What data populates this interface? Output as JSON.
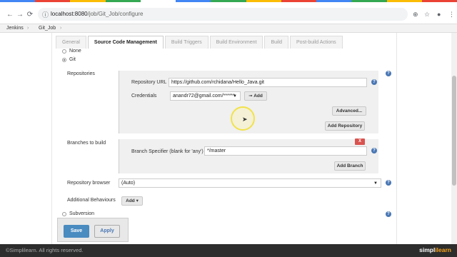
{
  "colorbar": [
    "#4285f4",
    "#ea4335",
    "#fbbc05",
    "#34a853",
    "#ffffff",
    "#4285f4",
    "#34a853",
    "#fbbc05",
    "#ea4335",
    "#4285f4",
    "#34a853",
    "#fbbc05",
    "#ea4335"
  ],
  "browser": {
    "url_host": "localhost:8080",
    "url_path": "/job/Git_Job/configure"
  },
  "breadcrumb": {
    "items": [
      "Jenkins",
      "Git_Job"
    ],
    "separator": "›"
  },
  "tabs": [
    "General",
    "Source Code Management",
    "Build Triggers",
    "Build Environment",
    "Build",
    "Post-build Actions"
  ],
  "active_tab": "Source Code Management",
  "scm": {
    "none_label": "None",
    "git_label": "Git",
    "subversion_label": "Subversion",
    "selected": "Git"
  },
  "repositories": {
    "section_label": "Repositories",
    "url_label": "Repository URL",
    "url_value": "https://github.com/rchidana/Hello_Java.git",
    "credentials_label": "Credentials",
    "credentials_value": "anandr72@gmail.com/******",
    "add_button": "Add",
    "advanced_button": "Advanced...",
    "add_repository_button": "Add Repository"
  },
  "branches": {
    "section_label": "Branches to build",
    "specifier_label": "Branch Specifier (blank for 'any')",
    "specifier_value": "*/master",
    "delete_button": "X",
    "add_branch_button": "Add Branch"
  },
  "repo_browser": {
    "label": "Repository browser",
    "value": "(Auto)"
  },
  "additional": {
    "label": "Additional Behaviours",
    "add_button": "Add"
  },
  "actions": {
    "save": "Save",
    "apply": "Apply"
  },
  "footer": {
    "copyright": "©Simplilearn. All rights reserved.",
    "logo_part1": "simpl",
    "logo_part2": "ilearn"
  }
}
